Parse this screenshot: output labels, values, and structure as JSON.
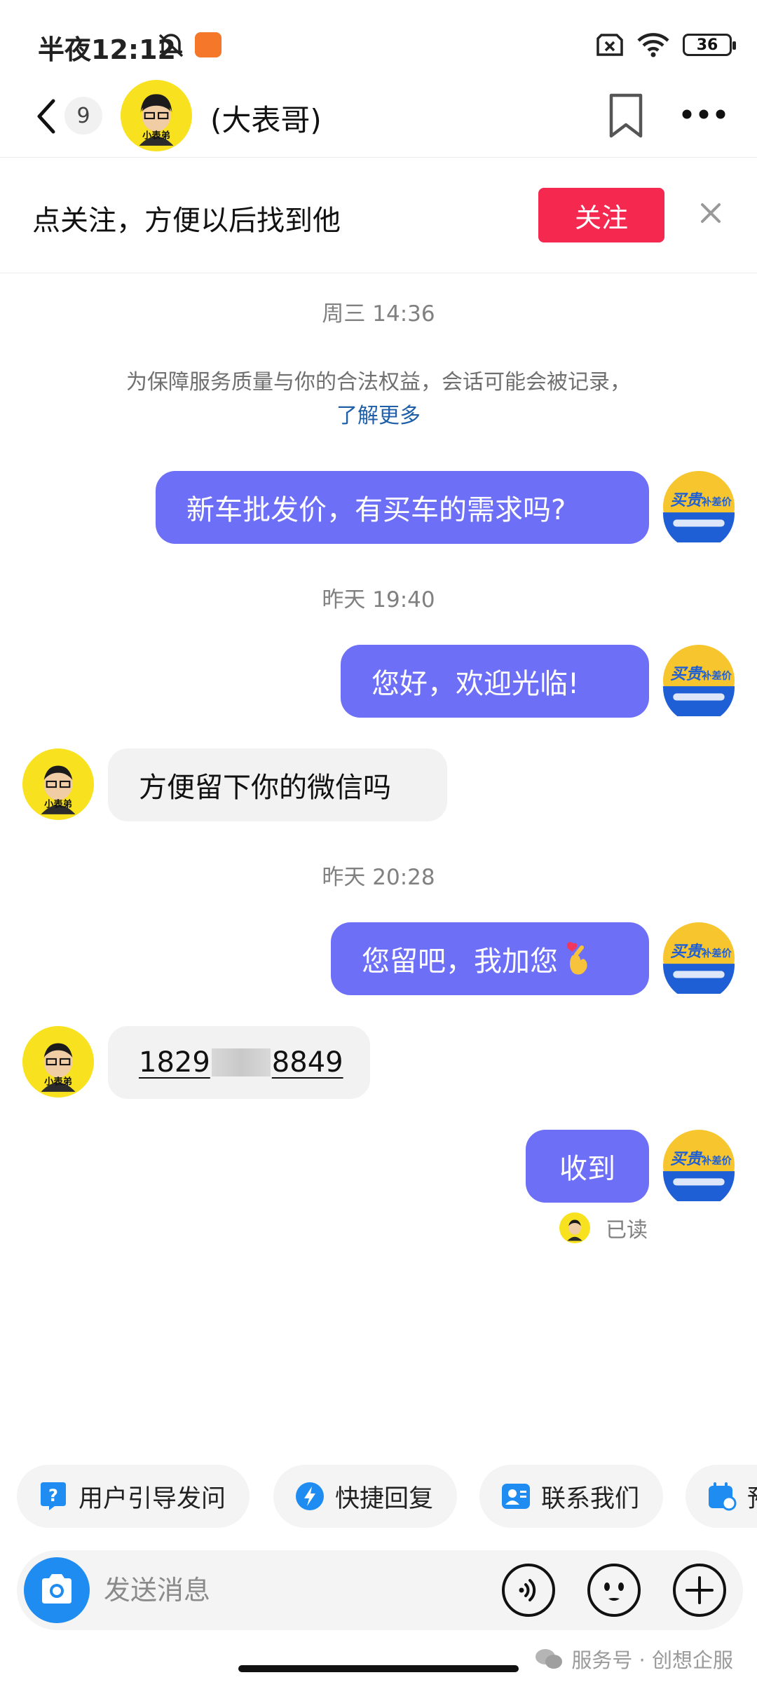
{
  "status": {
    "time": "半夜12:12",
    "battery": "36"
  },
  "nav": {
    "unread_count": "9",
    "title": "(大表哥)"
  },
  "follow": {
    "text": "点关注，方便以后找到他",
    "button": "关注"
  },
  "chat": {
    "ts1": "周三 14:36",
    "notice": "为保障服务质量与你的合法权益，会话可能会被记录，",
    "notice_link": "了解更多",
    "m1": "新车批发价，有买车的需求吗?",
    "ts2": "昨天 19:40",
    "m2": "您好，欢迎光临!",
    "m3": "方便留下你的微信吗",
    "ts3": "昨天 20:28",
    "m4": "您留吧，我加您",
    "m5_a": "1829",
    "m5_b": "8849",
    "m6": "收到",
    "read": "已读"
  },
  "avatars": {
    "self_brand": "买贵",
    "self_brand_tag": "补差价",
    "other_label": "小表弟"
  },
  "chips": [
    "用户引导发问",
    "快捷回复",
    "联系我们",
    "预约"
  ],
  "input": {
    "placeholder": "发送消息"
  },
  "watermark": "服务号 · 创想企服",
  "colors": {
    "outgoing": "#6d6ff7",
    "follow": "#f5284f",
    "camera": "#1e8cf1",
    "incoming": "#f2f2f2"
  }
}
